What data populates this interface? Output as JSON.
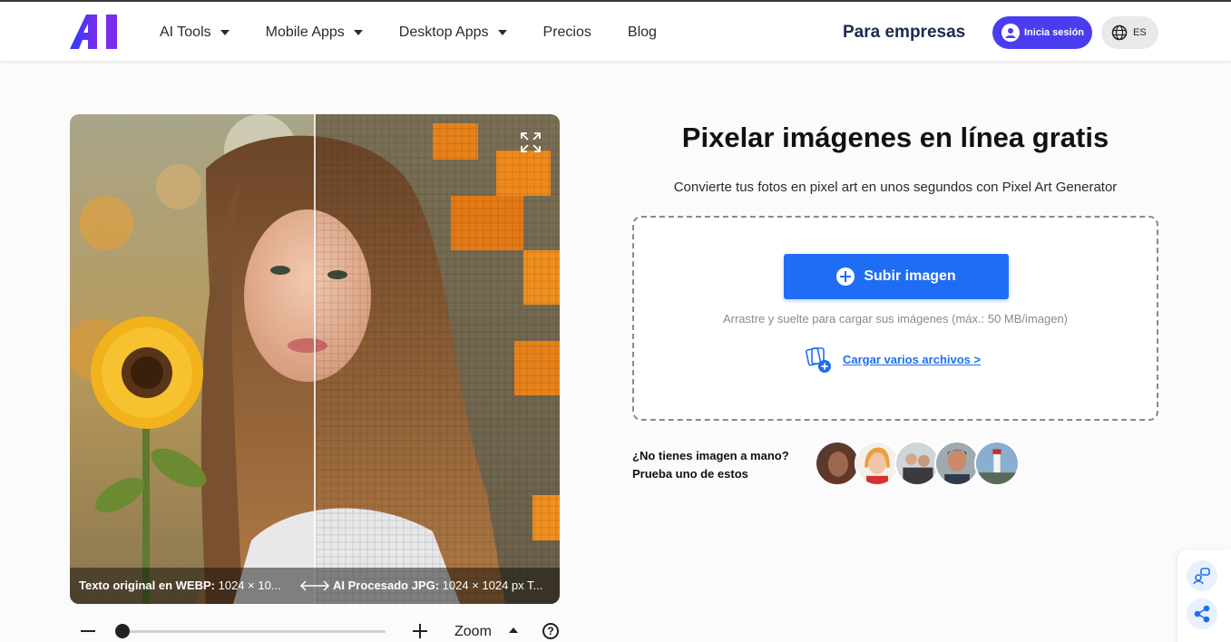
{
  "header": {
    "logo_text": "AI",
    "nav": [
      {
        "label": "AI Tools",
        "has_dropdown": true
      },
      {
        "label": "Mobile Apps",
        "has_dropdown": true
      },
      {
        "label": "Desktop Apps",
        "has_dropdown": true
      },
      {
        "label": "Precios",
        "has_dropdown": false
      },
      {
        "label": "Blog",
        "has_dropdown": false
      }
    ],
    "enterprise_label": "Para empresas",
    "login_label": "Inicia sesión",
    "language": "ES"
  },
  "comparison": {
    "left_caption_bold": "Texto original en WEBP:",
    "left_caption_rest": " 1024 × 10...",
    "right_caption_bold": "AI Procesado JPG:",
    "right_caption_rest": " 1024 × 1024 px   T...",
    "expand_icon": "expand-icon",
    "split_percent": 50
  },
  "zoom": {
    "label": "Zoom",
    "level_fraction": 0.0,
    "help_symbol": "?"
  },
  "main": {
    "title": "Pixelar imágenes en línea gratis",
    "subtitle": "Convierte tus fotos en pixel art en unos segundos con Pixel Art Generator",
    "upload_button": "Subir imagen",
    "drop_hint": "Arrastre y suelte para cargar sus imágenes (máx.: 50 MB/imagen)",
    "multi_files_link": "Cargar varios archivos >",
    "samples_line1": "¿No tienes imagen a mano?",
    "samples_line2": "Prueba uno de estos"
  },
  "colors": {
    "primary": "#1f6df5",
    "login": "#4a3df0",
    "enterprise_text": "#1b2a4e",
    "logo_gradient_start": "#2b3cf5",
    "logo_gradient_end": "#7a2df0"
  },
  "side_icons": [
    "feedback-icon",
    "share-icon"
  ]
}
